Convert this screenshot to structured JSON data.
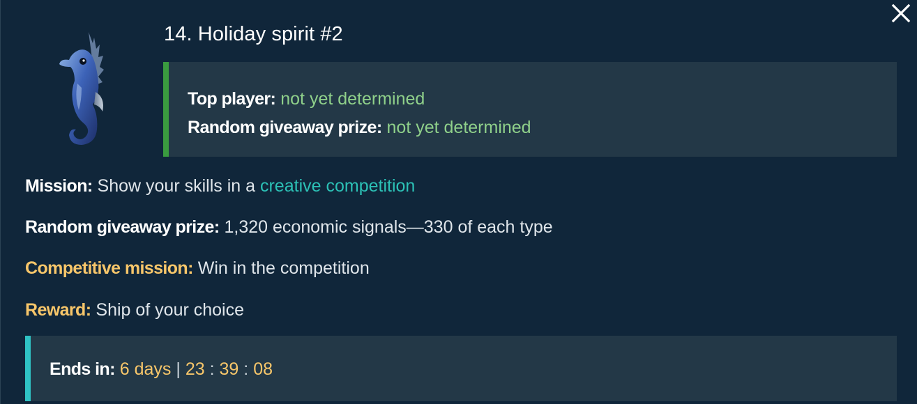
{
  "title": "14. Holiday spirit #2",
  "status": {
    "top_player_label": "Top player:",
    "top_player_value": "not yet determined",
    "giveaway_label": "Random giveaway prize:",
    "giveaway_value": "not yet determined"
  },
  "details": {
    "mission_label": "Mission:",
    "mission_text": "Show your skills in a",
    "mission_link": "creative competition",
    "prize_label": "Random giveaway prize:",
    "prize_text": "1,320 economic signals—330 of each type",
    "competitive_label": "Competitive mission:",
    "competitive_text": "Win in the competition",
    "reward_label": "Reward:",
    "reward_text": "Ship of your choice"
  },
  "timer": {
    "label": "Ends in:",
    "days": "6 days",
    "separator": "|",
    "hours": "23",
    "minutes": "39",
    "seconds": "08",
    "colon": ":"
  },
  "icons": {
    "close": "close-x-icon",
    "item": "seahorse-icon"
  },
  "colors": {
    "background": "#10263a",
    "panel": "#233847",
    "status_accent": "#3a9b3f",
    "timer_accent": "#2fc2c4",
    "green_text": "#8fd08a",
    "link_text": "#2cc1b6",
    "gold_text": "#f7c66a"
  }
}
